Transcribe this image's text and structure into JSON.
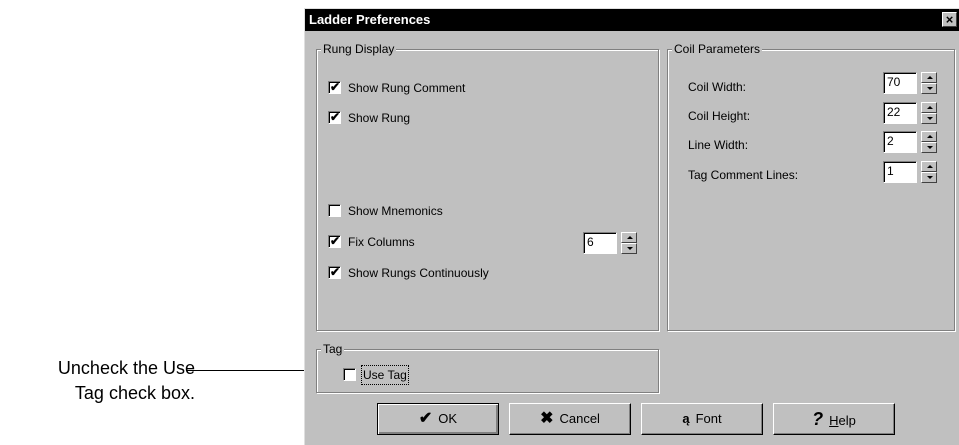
{
  "annotation": {
    "line1": "Uncheck the Use",
    "line2": "Tag check box."
  },
  "dialog": {
    "title": "Ladder Preferences",
    "close_glyph": "×"
  },
  "rung_display": {
    "title": "Rung Display",
    "show_rung_comment": {
      "label": "Show Rung Comment",
      "checked": true
    },
    "show_rung": {
      "label": "Show Rung",
      "checked": true
    },
    "show_mnemonics": {
      "label": "Show Mnemonics",
      "checked": false
    },
    "fix_columns": {
      "label": "Fix Columns",
      "checked": true,
      "value": "6"
    },
    "show_rungs_continuously": {
      "label": "Show Rungs Continuously",
      "checked": true
    }
  },
  "coil_parameters": {
    "title": "Coil Parameters",
    "coil_width": {
      "label": "Coil Width:",
      "value": "70"
    },
    "coil_height": {
      "label": "Coil Height:",
      "value": "22"
    },
    "line_width": {
      "label": "Line Width:",
      "value": "2"
    },
    "tag_comment_lines": {
      "label": "Tag Comment Lines:",
      "value": "1"
    }
  },
  "tag": {
    "title": "Tag",
    "use_tag": {
      "label": "Use Tag",
      "checked": false
    }
  },
  "buttons": {
    "ok": {
      "label": "OK",
      "icon": "checkmark-icon"
    },
    "cancel": {
      "label": "Cancel",
      "icon": "x-icon"
    },
    "font": {
      "label": "Font",
      "icon": "font-icon"
    },
    "help": {
      "label_first": "H",
      "label_rest": "elp",
      "icon": "question-icon"
    }
  },
  "check_glyph": "✔"
}
